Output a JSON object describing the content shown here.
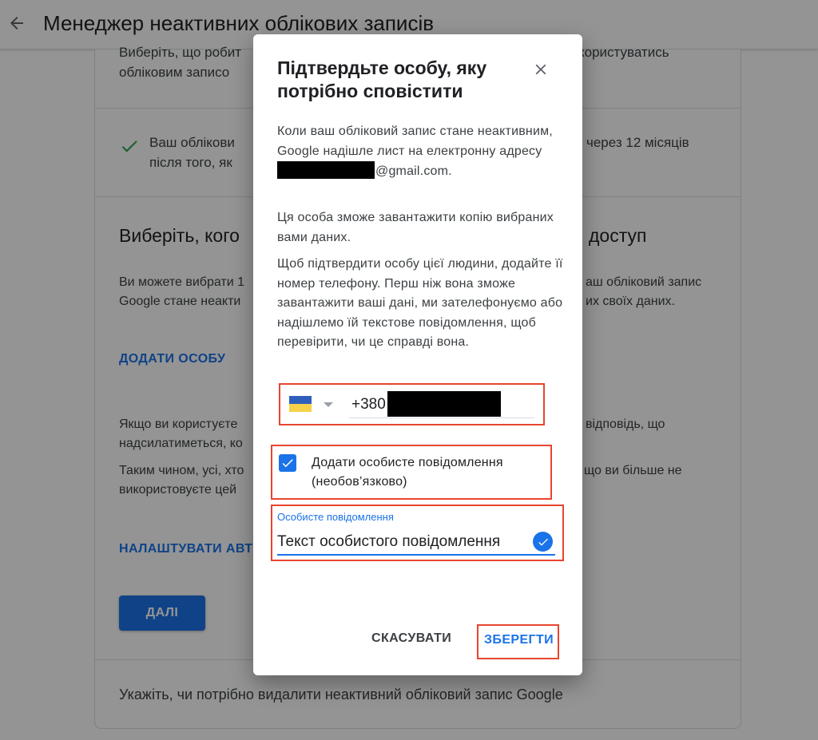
{
  "header": {
    "title": "Менеджер неактивних облікових записів"
  },
  "background": {
    "intro_line1_left": "Виберіть, що робит",
    "intro_line1_right": "користуватись",
    "intro_line2_left": "обліковим записо",
    "status_line1_left": "Ваш облікови",
    "status_line1_right": "через 12 місяців",
    "status_line2_left": "після того, як",
    "section_heading_left": "Виберіть, кого",
    "section_heading_right": "доступ",
    "desc_line1_left": "Ви можете вибрати 1",
    "desc_line1_right": "аш обліковий запис",
    "desc_line2_left": "Google стане неакти",
    "desc_line2_right": "их своїх даних.",
    "add_person_link": "ДОДАТИ ОСОБУ",
    "reply_line1_left": "Якщо ви користуєте",
    "reply_line1_right": "відповідь, що",
    "reply_line2_left": "надсилатиметься, ко",
    "everyone_line1_left": "Таким чином, усі, хто",
    "everyone_line1_right": "що ви більше не",
    "everyone_line2_left": "використовуєте цей",
    "setup_link": "НАЛАШТУВАТИ АВТ",
    "next_button": "ДАЛІ",
    "delete_section": "Укажіть, чи потрібно видалити неактивний обліковий запис Google",
    "check_icon_color": "#34a853"
  },
  "dialog": {
    "title": "Підтвердьте особу, яку потрібно сповістити",
    "para1_text": "Коли ваш обліковий запис стане неактивним, Google надішле лист на електронну адресу",
    "para1_email_suffix": "@gmail.com.",
    "para2": "Ця особа зможе завантажити копію вибраних вами даних.",
    "para3": "Щоб підтвердити особу цієї людини, додайте її номер телефону. Перш ніж вона зможе завантажити ваші дані, ми зателефонуємо або надішлемо їй текстове повідомлення, щоб перевірити, чи це справді вона.",
    "phone": {
      "country_flag": "ukraine-flag",
      "country_code": "+380"
    },
    "personal_message_checkbox": {
      "label": "Додати особисте повідомлення (необов’язково)",
      "checked": true
    },
    "message_field": {
      "label": "Особисте повідомлення",
      "value": "Текст особистого повідомлення"
    },
    "cancel_button": "СКАСУВАТИ",
    "save_button": "ЗБЕРЕГТИ"
  },
  "colors": {
    "accent": "#1a73e8",
    "highlight": "#e8452f"
  }
}
